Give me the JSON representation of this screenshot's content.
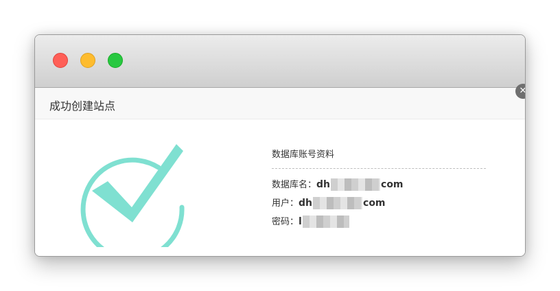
{
  "window": {
    "buttons": {
      "close": "close-window",
      "minimize": "minimize-window",
      "zoom": "zoom-window"
    }
  },
  "dialog": {
    "title": "成功创建站点",
    "close_icon": "✕"
  },
  "database": {
    "section_title": "数据库账号资料",
    "name_label": "数据库名：",
    "name_prefix": "dh",
    "name_suffix": "com",
    "user_label": "用户：",
    "user_prefix": "dh",
    "user_suffix": "com",
    "password_label": "密码：",
    "password_prefix": "l"
  },
  "colors": {
    "success_icon": "#7fe0d1",
    "close_light": "#ff5f57",
    "minimize_light": "#febc2e",
    "zoom_light": "#28c840"
  }
}
